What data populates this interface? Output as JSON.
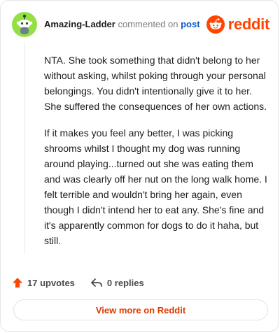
{
  "comment": {
    "author": "Amazing-Ladder",
    "action_text": "commented on",
    "target_text": "post",
    "paragraphs": [
      "NTA. She took something that didn't belong to her without asking, whilst poking through your personal belongings. You didn't intentionally give it to her. She suffered the consequences of her own actions.",
      "If it makes you feel any better, I was picking shrooms whilst I thought my dog was running around playing...turned out she was eating them and was clearly off her nut on the long walk home. I felt terrible and wouldn't bring her again, even though I didn't intend her to eat any. She's fine and it's apparently common for dogs to do it haha, but still."
    ]
  },
  "brand": {
    "name": "reddit",
    "icon": "reddit-logo-icon",
    "color": "#ff4500"
  },
  "stats": {
    "upvotes_label": "17 upvotes",
    "replies_label": "0 replies",
    "upvote_icon": "upvote-arrow-icon",
    "reply_icon": "reply-arrow-icon",
    "upvote_color": "#ff4500"
  },
  "footer": {
    "view_more_label": "View more on Reddit",
    "link_color": "#d93a00"
  },
  "colors": {
    "avatar_bg": "#94e044",
    "post_link": "#0b57d0"
  }
}
